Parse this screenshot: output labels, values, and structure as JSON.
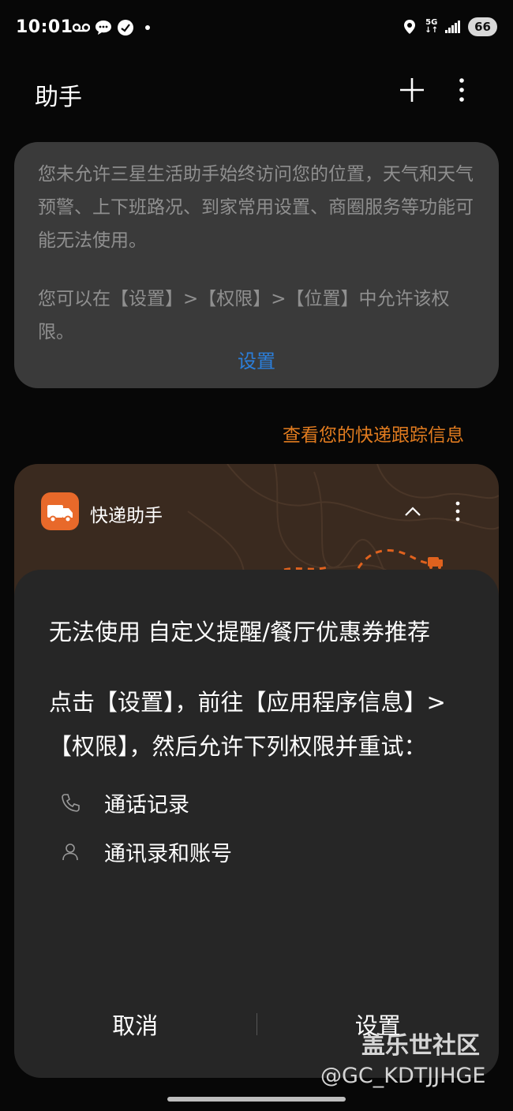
{
  "status_bar": {
    "time": "10:01",
    "network": "5G",
    "battery": "66"
  },
  "header": {
    "title": "助手"
  },
  "location_card": {
    "message": "您未允许三星生活助手始终访问您的位置，天气和天气预警、上下班路况、到家常用设置、商圈服务等功能可能无法使用。",
    "hint": "您可以在【设置】>【权限】>【位置】中允许该权限。",
    "settings_link": "设置",
    "link_color": "#2b7fdc"
  },
  "tracking_link": {
    "label": "查看您的快递跟踪信息",
    "color": "#e07b1f"
  },
  "express_card": {
    "name": "快递助手",
    "logo_color": "#e8692a"
  },
  "dialog": {
    "title": "无法使用 自定义提醒/餐厅优惠券推荐",
    "body": "点击【设置】，前往【应用程序信息】>【权限】，然后允许下列权限并重试：",
    "permissions": [
      {
        "label": "通话记录",
        "icon": "phone-icon"
      },
      {
        "label": "通讯录和账号",
        "icon": "person-icon"
      }
    ],
    "cancel_label": "取消",
    "settings_label": "设置"
  },
  "watermark": {
    "line1": "盖乐世社区",
    "line2": "@GC_KDTJJHGE"
  }
}
